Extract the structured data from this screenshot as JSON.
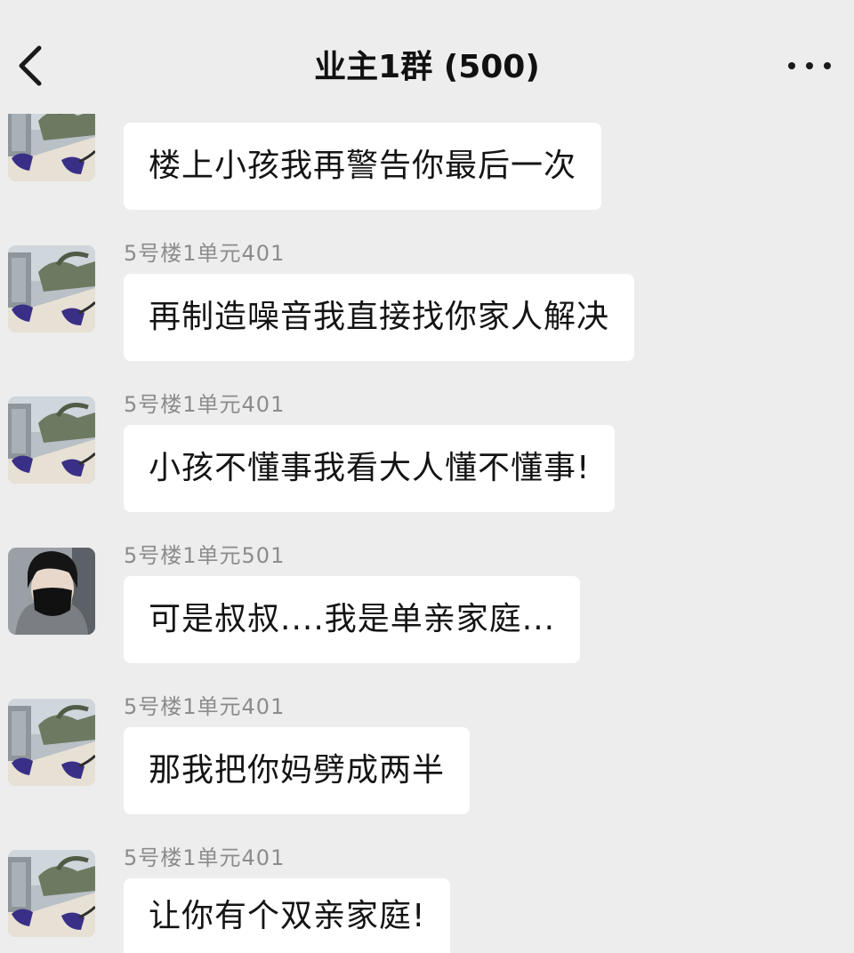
{
  "header": {
    "title": "业主1群 (500)"
  },
  "messages": [
    {
      "sender": "",
      "text": "楼上小孩我再警告你最后一次",
      "avatar": "building-avatar"
    },
    {
      "sender": "5号楼1单元401",
      "text": "再制造噪音我直接找你家人解决",
      "avatar": "building-avatar"
    },
    {
      "sender": "5号楼1单元401",
      "text": "小孩不懂事我看大人懂不懂事!",
      "avatar": "building-avatar"
    },
    {
      "sender": "5号楼1单元501",
      "text": "可是叔叔....我是单亲家庭...",
      "avatar": "person-avatar"
    },
    {
      "sender": "5号楼1单元401",
      "text": "那我把你妈劈成两半",
      "avatar": "building-avatar"
    },
    {
      "sender": "5号楼1单元401",
      "text": "让你有个双亲家庭!",
      "avatar": "building-avatar"
    }
  ]
}
